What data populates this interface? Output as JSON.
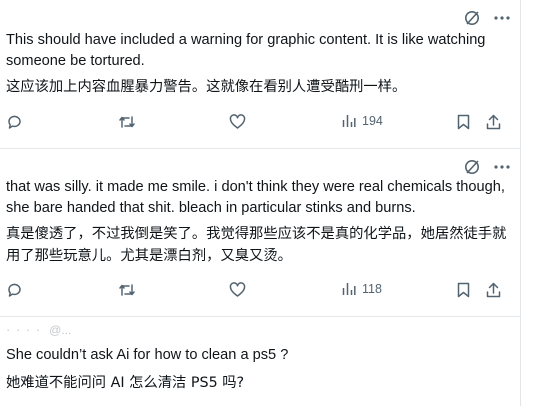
{
  "posts": [
    {
      "text_en": "This should have included a warning for graphic content. It is like watching someone be tortured.",
      "text_zh": "这应该加上内容血腥暴力警告。这就像在看别人遭受酷刑一样。",
      "views": "194"
    },
    {
      "text_en": "that was silly.  it made me smile.  i don't think they were real chemicals though, she bare handed that shit.  bleach in particular stinks and burns.",
      "text_zh": "真是傻透了，不过我倒是笑了。我觉得那些应该不是真的化学品，她居然徒手就用了那些玩意儿。尤其是漂白剂，又臭又烫。",
      "views": "118"
    },
    {
      "header_dots": "· · · ·",
      "header_handle": "@...",
      "text_en": "She couldn’t ask Ai for how to clean a ps5 ?",
      "text_zh": "她难道不能问问 AI 怎么清洁 PS5 吗?"
    }
  ],
  "icons": {
    "grok": "grok-icon",
    "more": "more-icon",
    "reply": "reply-icon",
    "repost": "repost-icon",
    "like": "like-icon",
    "views": "views-icon",
    "bookmark": "bookmark-icon",
    "share": "share-icon"
  },
  "colors": {
    "text": "#0f1419",
    "muted": "#536471",
    "divider": "#e6e9ec"
  }
}
